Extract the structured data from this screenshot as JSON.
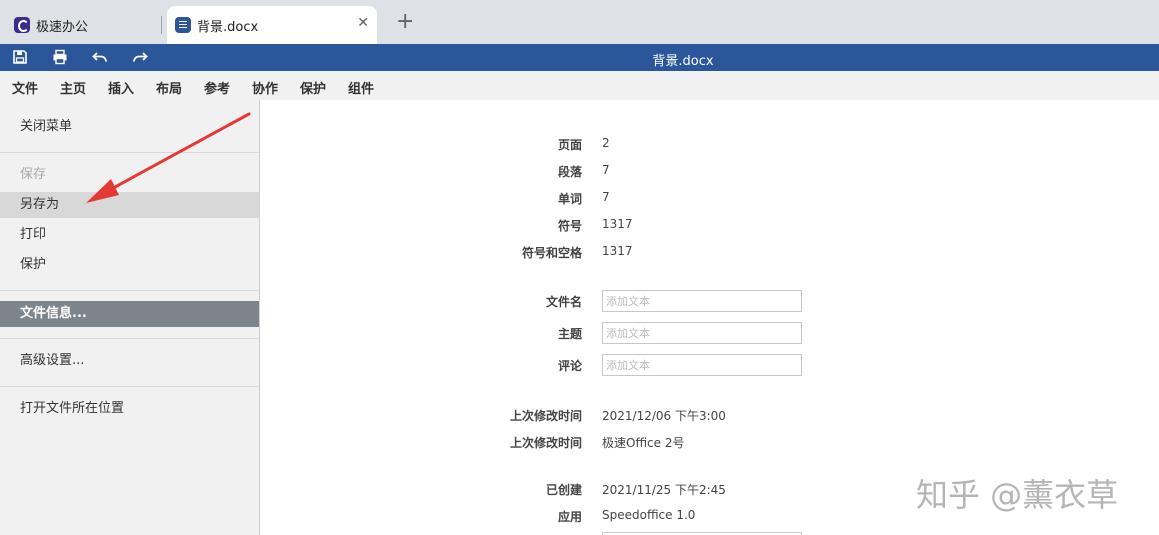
{
  "browser": {
    "tabs": [
      {
        "label": "极速办公",
        "icon": "speedoffice-logo-icon"
      },
      {
        "label": "背景.docx",
        "icon": "document-icon"
      }
    ],
    "new_tab_symbol": "+",
    "close_symbol": "✕"
  },
  "titlebar": {
    "title": "背景.docx",
    "icons": [
      "save-icon",
      "print-icon",
      "undo-icon",
      "redo-icon"
    ],
    "color": "#2b579a"
  },
  "menubar": {
    "items": [
      "文件",
      "主页",
      "插入",
      "布局",
      "参考",
      "协作",
      "保护",
      "组件"
    ],
    "active": "文件"
  },
  "file_menu": {
    "items": [
      {
        "label": "关闭菜单"
      },
      {
        "label": "保存",
        "state": "disabled"
      },
      {
        "label": "另存为",
        "state": "hover"
      },
      {
        "label": "打印"
      },
      {
        "label": "保护"
      },
      {
        "label": "文件信息...",
        "state": "selected"
      },
      {
        "label": "高级设置..."
      },
      {
        "label": "打开文件所在位置"
      }
    ]
  },
  "doc_info": {
    "stats": [
      {
        "label": "页面",
        "value": "2"
      },
      {
        "label": "段落",
        "value": "7"
      },
      {
        "label": "单词",
        "value": "7"
      },
      {
        "label": "符号",
        "value": "1317"
      },
      {
        "label": "符号和空格",
        "value": "1317"
      }
    ],
    "fields": [
      {
        "label": "文件名",
        "value": "",
        "placeholder": "添加文本"
      },
      {
        "label": "主题",
        "value": "",
        "placeholder": "添加文本"
      },
      {
        "label": "评论",
        "value": "",
        "placeholder": "添加文本"
      }
    ],
    "modified": [
      {
        "label": "上次修改时间",
        "value": "2021/12/06 下午3:00"
      },
      {
        "label": "上次修改时间",
        "value": "极速Office 2号"
      }
    ],
    "created": [
      {
        "label": "已创建",
        "value": "2021/11/25 下午2:45"
      },
      {
        "label": "应用",
        "value": "Speedoffice 1.0"
      }
    ]
  },
  "watermark": "知乎 @薰衣草",
  "annotation_color": "#e53935"
}
